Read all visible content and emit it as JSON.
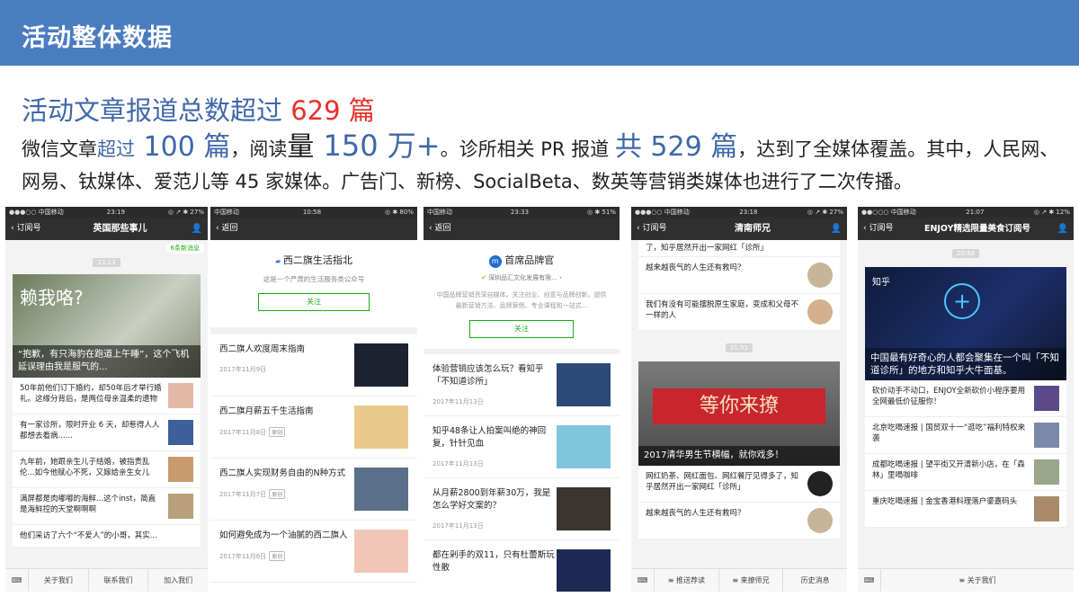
{
  "banner": {
    "title": "活动整体数据"
  },
  "headline": {
    "text": "活动文章报道总数超过 ",
    "highlight": "629 篇"
  },
  "paragraph": {
    "p1": "微信文章",
    "p2": "超过",
    "p3": " 100 篇",
    "p4": "，阅读",
    "p5": "量",
    "p6": " 150 万+",
    "p7": "。诊所相关 PR 报道 ",
    "p8": "共 529 篇",
    "p9": "，达到了全媒体覆盖。其中，人民网、网易、钛媒体、爱范儿等 45 家媒体。广告门、新榜、SocialBeta、数英等营销类媒体也进行了二次传播。"
  },
  "phone1": {
    "status": {
      "carrier": "●●●○○ 中国移动 ",
      "time": "23:19",
      "battery": "◎ ↗ ✱ 27%"
    },
    "nav": {
      "back": "订阅号",
      "title": "英国那些事儿"
    },
    "new_msgs": "6条新消息",
    "time_chip": "23:13",
    "hero_title": "赖我咯?",
    "hero_caption": "“抱歉，有只海豹在跑道上午睡”，这个飞机延误理由我是服气的...",
    "rows": [
      "50年前他们订下婚约，却50年后才举行婚礼。这缘分背后，是两位母亲温柔的遗物",
      "有一家诊所，限时开业 6 天，却惹得人人都想去看病......",
      "九年前，她跟亲生儿子结婚，被指责乱伦...如今他赋心不死，又嫁给亲生女儿",
      "满屏都是肉嘟嘟的海鲜...这个inst，简直是海鲜控的天堂啊啊啊",
      "他们采访了六个“不爱人”的小哥，其实..."
    ],
    "tabs": [
      "关于我们",
      "联系我们",
      "加入我们"
    ]
  },
  "phone2": {
    "status": {
      "carrier": "中国移动 ",
      "time": "10:58",
      "battery": "◎ ✱ 80%"
    },
    "nav": {
      "back": "返回"
    },
    "account_name": "西二旗生活指北",
    "account_desc": "这是一个严肃的生活服务类公众号",
    "follow": "关注",
    "items": [
      {
        "title": "西二旗人欢度周末指南",
        "date": "2017年11月9日",
        "badge": ""
      },
      {
        "title": "西二旗月薪五千生活指南",
        "date": "2017年11月8日",
        "badge": "原创"
      },
      {
        "title": "西二旗人实现财务自由的N种方式",
        "date": "2017年11月7日",
        "badge": "原创"
      },
      {
        "title": "如何避免成为一个油腻的西二旗人",
        "date": "2017年11月6日",
        "badge": "原创"
      }
    ]
  },
  "phone3": {
    "status": {
      "carrier": "中国移动 ",
      "time": "23:33",
      "battery": "◎ ✱ 51%"
    },
    "nav": {
      "back": "返回"
    },
    "account_name": "首席品牌官",
    "account_org": "深圳品汇文化发展有限...",
    "account_desc": "中国品牌营销资深自媒体。关注创业、创意与品牌创新，提供最新营销方法、品牌案例、专业课程和一站式...",
    "follow": "关注",
    "items": [
      {
        "title": "体验营销应该怎么玩？看知乎「不知道诊所」",
        "date": "2017年11月13日"
      },
      {
        "title": "知乎48条让人拍案叫绝的神回复，针针见血",
        "date": "2017年11月13日"
      },
      {
        "title": "从月薪2800到年薪30万，我是怎么学好文案的？",
        "date": "2017年11月13日"
      },
      {
        "title": "都在剁手的双11，只有杜蕾斯玩性散",
        "date": ""
      }
    ]
  },
  "phone4": {
    "status": {
      "carrier": "●●●○○ 中国移动 ",
      "time": "23:18",
      "battery": "◎ ↗ ✱ 27%"
    },
    "nav": {
      "back": "订阅号",
      "title": "清南师兄"
    },
    "top_rows": [
      "了，知乎居然开出一家网红「诊所」",
      "越来越丧气的人生还有救吗？",
      "我们有没有可能摆脱原生家庭，变成和父母不一样的人"
    ],
    "time_chip": "21:51",
    "banner_text": "等你来撩",
    "hero_caption": "2017清华男生节横幅，就你戏多！",
    "rows": [
      "网红奶茶、网红面包、网红餐厅见得多了，知乎居然开出一家网红「诊所」",
      "越来越丧气的人生还有救吗？"
    ],
    "tabs": [
      "推送荐读",
      "来撩师兄",
      "历史消息"
    ]
  },
  "phone5": {
    "status": {
      "carrier": "●●○○○ 中国移动 ",
      "time": "21:07",
      "battery": "◎ ↗ ✱ 12%"
    },
    "nav": {
      "back": "订阅号",
      "title": "ENJOY精选限量美食订阅号"
    },
    "time_chip": "20:58",
    "hero_brand": "知乎",
    "hero_caption": "中国最有好奇心的人都会聚集在一个叫「不知道诊所」的地方和知乎大牛面基。",
    "rows": [
      "砍价动手不动口，ENJOY全新砍价小程序要用全网最低价征服你！",
      "北京吃喝速报 | 国贸双十一“逛吃”福利特权来袭",
      "成都吃喝速报 | 望平街又开清新小店，在「森林」里喝咖啡",
      "重庆吃喝速报 | 金宝香港料理落户鎏嘉码头"
    ],
    "tabs": [
      "关于我们"
    ]
  },
  "colors": {
    "banner": "#4a7cc0",
    "accent_blue": "#3f67a8",
    "accent_red": "#e8312b",
    "wechat_green": "#1aad19"
  }
}
